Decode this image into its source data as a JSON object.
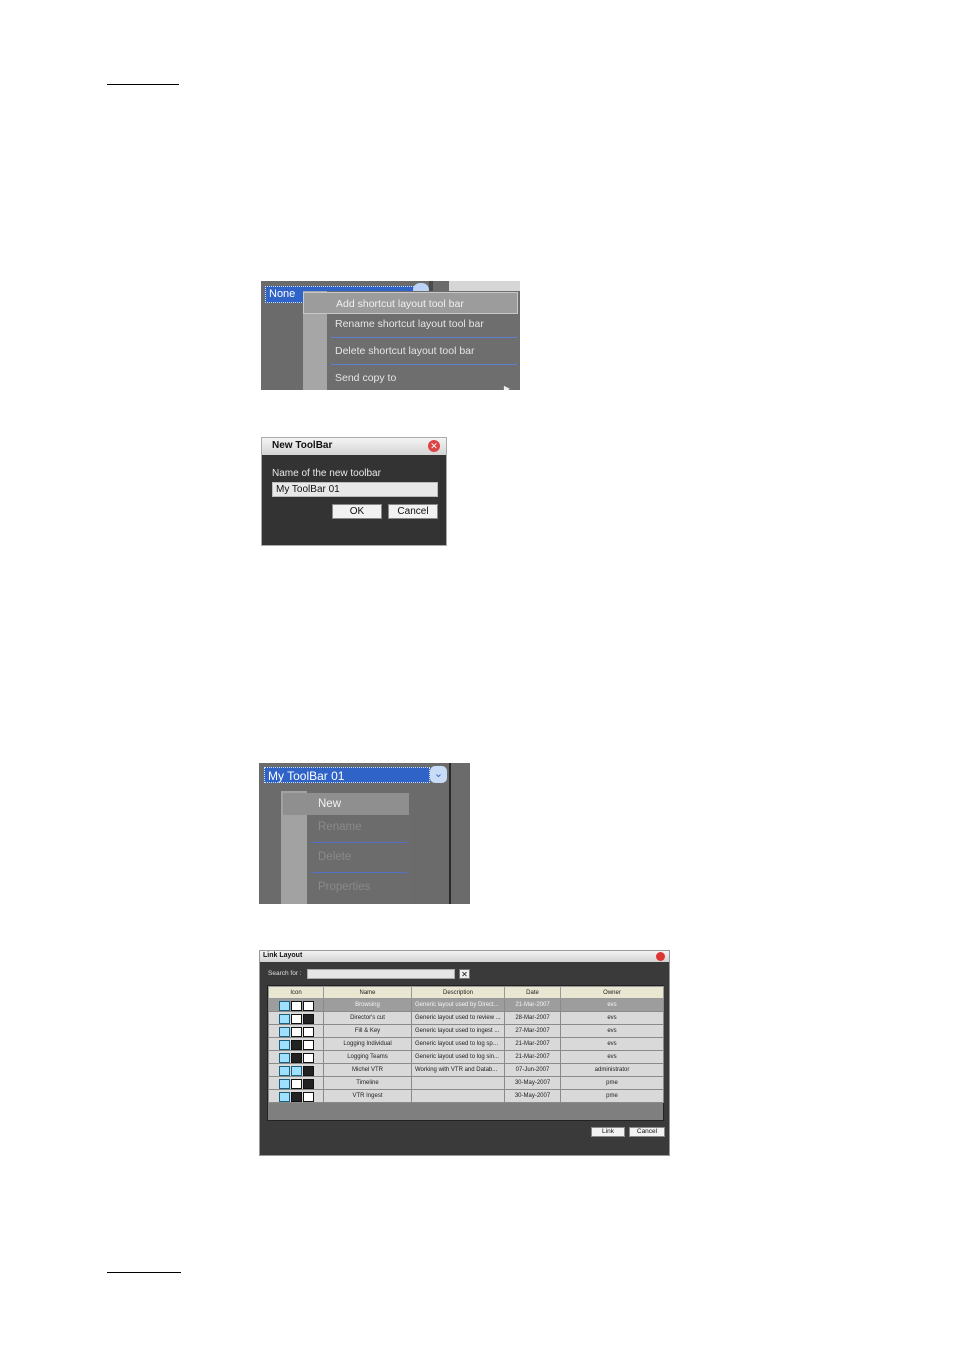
{
  "context_menu": {
    "combo_value": "None",
    "items": [
      {
        "label": "Add shortcut layout tool bar"
      },
      {
        "label": "Rename shortcut layout tool bar"
      },
      {
        "label": "Delete shortcut layout tool bar"
      },
      {
        "label": "Send copy to"
      }
    ]
  },
  "new_toolbar_dialog": {
    "title": "New ToolBar",
    "field_label": "Name of the new toolbar",
    "field_value": "My ToolBar 01",
    "ok_label": "OK",
    "cancel_label": "Cancel"
  },
  "toolbar_dropdown": {
    "combo_value": "My ToolBar 01",
    "items": [
      {
        "label": "New",
        "enabled": true
      },
      {
        "label": "Rename",
        "enabled": false
      },
      {
        "label": "Delete",
        "enabled": false
      },
      {
        "label": "Properties",
        "enabled": false
      }
    ]
  },
  "link_layout_dialog": {
    "title": "Link Layout",
    "search_label": "Search for :",
    "search_value": "",
    "clear_label": "✕",
    "columns": [
      "Icon",
      "Name",
      "Description",
      "Date",
      "Owner"
    ],
    "rows": [
      {
        "name": "Browsing",
        "description": "Generic layout used by Direct...",
        "date": "21-Mar-2007",
        "owner": "evs"
      },
      {
        "name": "Director's cut",
        "description": "Generic layout used to review ...",
        "date": "28-Mar-2007",
        "owner": "evs"
      },
      {
        "name": "Fill & Key",
        "description": "Generic layout used to ingest ...",
        "date": "27-Mar-2007",
        "owner": "evs"
      },
      {
        "name": "Logging Individual",
        "description": "Generic layout used to log spo...",
        "date": "21-Mar-2007",
        "owner": "evs"
      },
      {
        "name": "Logging Teams",
        "description": "Generic layout used to log sin...",
        "date": "21-Mar-2007",
        "owner": "evs"
      },
      {
        "name": "Michel VTR",
        "description": "Working with VTR and Datab...",
        "date": "07-Jun-2007",
        "owner": "administrator"
      },
      {
        "name": "Timeline",
        "description": "",
        "date": "30-May-2007",
        "owner": "pme"
      },
      {
        "name": "VTR Ingest",
        "description": "",
        "date": "30-May-2007",
        "owner": "pme"
      }
    ],
    "link_label": "Link",
    "cancel_label": "Cancel"
  }
}
